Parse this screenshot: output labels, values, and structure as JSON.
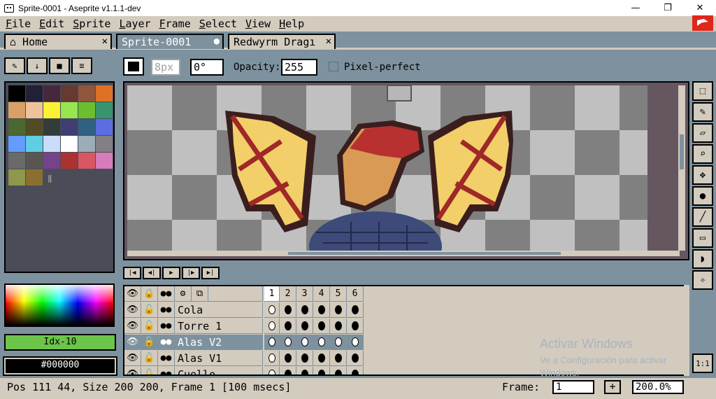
{
  "window": {
    "title": "Sprite-0001 - Aseprite v1.1.1-dev",
    "minimize": "—",
    "maximize": "❐",
    "close": "✕"
  },
  "menu": [
    "File",
    "Edit",
    "Sprite",
    "Layer",
    "Frame",
    "Select",
    "View",
    "Help"
  ],
  "tabs": [
    {
      "label": "⌂ Home",
      "close": "✕"
    },
    {
      "label": "Sprite-0001",
      "close": "●"
    },
    {
      "label": "Redwyrm Dragı",
      "close": "✕"
    }
  ],
  "toolbar": {
    "brush_size": "8px",
    "angle": "0°",
    "opacity_label": "Opacity:",
    "opacity_value": "255",
    "pixel_perfect_label": "Pixel-perfect"
  },
  "palette_colors": [
    "#000000",
    "#222034",
    "#45283c",
    "#663931",
    "#8f563b",
    "#df7126",
    "#d9a066",
    "#eec39a",
    "#fbf236",
    "#99e550",
    "#6abe30",
    "#37946e",
    "#4b692f",
    "#524b24",
    "#323c39",
    "#3f3f74",
    "#306082",
    "#5b6ee1",
    "#639bff",
    "#5fcde4",
    "#cbdbfc",
    "#ffffff",
    "#9badb7",
    "#847e87",
    "#696a6a",
    "#595652",
    "#76428a",
    "#ac3232",
    "#d95763",
    "#d77bba",
    "#8f974a",
    "#8a6f30"
  ],
  "color_index_label": "Idx-10",
  "color_hex_label": "#000000",
  "timeline": {
    "frames": [
      "1",
      "2",
      "3",
      "4",
      "5",
      "6"
    ],
    "layers": [
      {
        "name": "Cola",
        "selected": false
      },
      {
        "name": "Torre 1",
        "selected": false
      },
      {
        "name": "Alas V2",
        "selected": true
      },
      {
        "name": "Alas V1",
        "selected": false
      },
      {
        "name": "Cuello",
        "selected": false
      }
    ]
  },
  "watermark": {
    "title": "Activar Windows",
    "subtitle": "Ve a Configuración para activar Windows."
  },
  "status": {
    "info": "Pos 111 44, Size 200 200, Frame 1 [100 msecs]",
    "frame_label": "Frame:",
    "frame_value": "1",
    "plus": "+",
    "zoom": "200.0%"
  },
  "one_to_one": "1:1"
}
